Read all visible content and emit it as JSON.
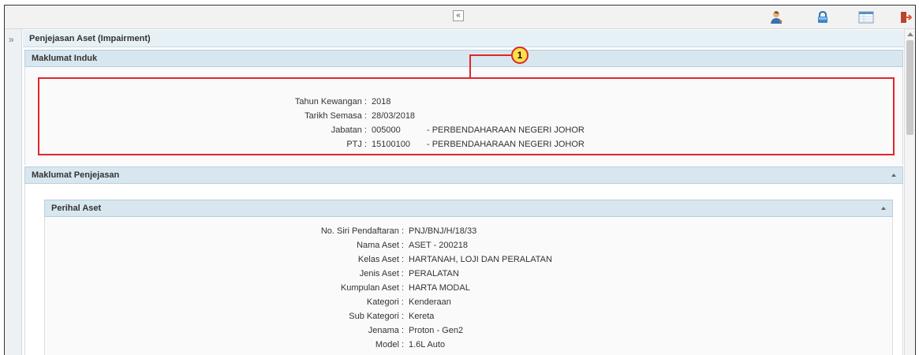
{
  "toolbar": {
    "collapse_symbol": "«",
    "icons": [
      "user-support-icon",
      "lock-icon",
      "table-view-icon",
      "logout-icon"
    ]
  },
  "gutter": {
    "expand_symbol": "»"
  },
  "page_title": "Penjejasan Aset (Impairment)",
  "maklumat_induk": {
    "title": "Maklumat Induk",
    "callout": "1",
    "fields": [
      {
        "label": "Tahun Kewangan :",
        "value": "2018",
        "desc": ""
      },
      {
        "label": "Tarikh Semasa :",
        "value": "28/03/2018",
        "desc": ""
      },
      {
        "label": "Jabatan :",
        "value": "005000",
        "desc": "- PERBENDAHARAAN NEGERI JOHOR"
      },
      {
        "label": "PTJ :",
        "value": "15100100",
        "desc": "- PERBENDAHARAAN NEGERI JOHOR"
      }
    ]
  },
  "maklumat_penjejasan": {
    "title": "Maklumat Penjejasan"
  },
  "perihal_aset": {
    "title": "Perihal Aset",
    "fields": [
      {
        "label": "No. Siri Pendaftaran :",
        "value": "PNJ/BNJ/H/18/33"
      },
      {
        "label": "Nama Aset :",
        "value": "ASET - 200218"
      },
      {
        "label": "Kelas Aset :",
        "value": "HARTANAH, LOJI DAN PERALATAN"
      },
      {
        "label": "Jenis Aset :",
        "value": "PERALATAN"
      },
      {
        "label": "Kumpulan Aset :",
        "value": "HARTA MODAL"
      },
      {
        "label": "Kategori :",
        "value": "Kenderaan"
      },
      {
        "label": "Sub Kategori :",
        "value": "Kereta"
      },
      {
        "label": "Jenama :",
        "value": "Proton - Gen2"
      },
      {
        "label": "Model :",
        "value": "1.6L Auto"
      }
    ]
  }
}
